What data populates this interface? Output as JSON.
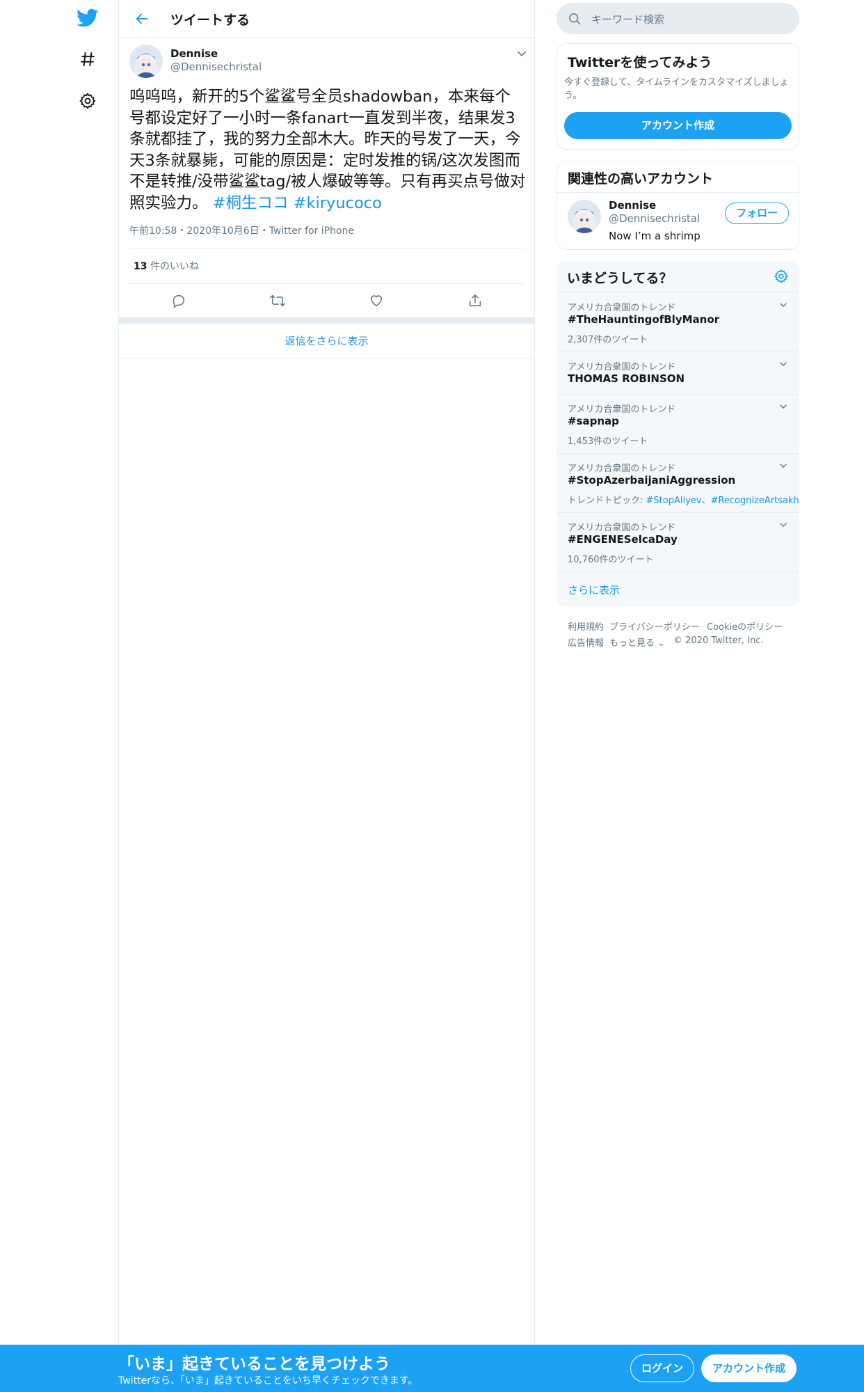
{
  "header": {
    "title": "ツイートする"
  },
  "tweet": {
    "author_name": "Dennise",
    "author_handle": "@Dennisechristal",
    "text": "呜呜呜，新开的5个鲨鲨号全员shadowban，本来每个号都设定好了一小时一条fanart一直发到半夜，结果发3条就都挂了，我的努力全部木大。昨天的号发了一天，今天3条就暴毙，可能的原因是：定时发推的锅/这次发图而不是转推/没带鲨鲨tag/被人爆破等等。只有再买点号做对照实验力。 ",
    "hashtag1": "#桐生ココ",
    "hashtag2": "#kiryucoco",
    "timestamp": "午前10:58・2020年10月6日・Twitter for iPhone",
    "likes_count": "13",
    "likes_label": " 件のいいね",
    "more_replies": "返信をさらに表示"
  },
  "search": {
    "placeholder": "キーワード検索"
  },
  "signup_card": {
    "title": "Twitterを使ってみよう",
    "description": "今すぐ登録して、タイムラインをカスタマイズしましょう。",
    "button": "アカウント作成"
  },
  "related_card": {
    "title": "関連性の高いアカウント",
    "name": "Dennise",
    "handle": "@Dennisechristal",
    "bio": "Now I’m a shrimp",
    "follow_button": "フォロー"
  },
  "trends": {
    "title": "いまどうしてる？",
    "items": [
      {
        "meta": "アメリカ合衆国のトレンド",
        "name": "#TheHauntingofBlyManor",
        "sub": "2,307件のツイート"
      },
      {
        "meta": "アメリカ合衆国のトレンド",
        "name": "THOMAS ROBINSON",
        "sub": ""
      },
      {
        "meta": "アメリカ合衆国のトレンド",
        "name": "#sapnap",
        "sub": "1,453件のツイート"
      },
      {
        "meta": "アメリカ合衆国のトレンド",
        "name": "#StopAzerbaijaniAggression",
        "sub_prefix": "トレンドトピック: ",
        "sub_link1": "#StopAliyev",
        "sub_sep": "、",
        "sub_link2": "#RecognizeArtsakh"
      },
      {
        "meta": "アメリカ合衆国のトレンド",
        "name": "#ENGENESelcaDay",
        "sub": "10,760件のツイート"
      }
    ],
    "show_more": "さらに表示"
  },
  "footer": {
    "terms": "利用規約",
    "privacy": "プライバシーポリシー",
    "cookie": "Cookieのポリシー",
    "ads": "広告情報",
    "more": "もっと見る",
    "copyright": "© 2020 Twitter, Inc."
  },
  "bottom_bar": {
    "title": "「いま」起きていることを見つけよう",
    "subtitle": "Twitterなら、「いま」起きていることをいち早くチェックできます。",
    "login": "ログイン",
    "signup": "アカウント作成"
  },
  "colors": {
    "accent": "#1da1f2",
    "link": "#1b95e0",
    "border": "#e6ecf0",
    "muted": "#657786"
  }
}
